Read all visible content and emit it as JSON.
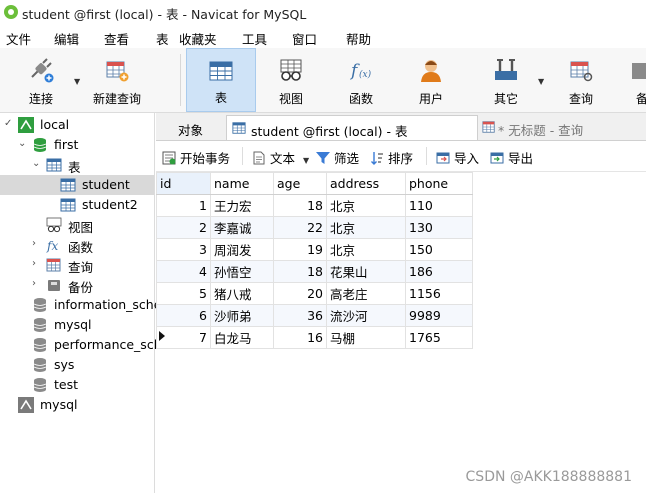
{
  "window": {
    "title": "student @first (local) - 表 - Navicat for MySQL"
  },
  "menu": [
    "文件",
    "编辑",
    "查看",
    "表",
    "收藏夹",
    "工具",
    "窗口",
    "帮助"
  ],
  "toolbar": {
    "buttons": [
      {
        "label": "连接",
        "icon": "connect-icon"
      },
      {
        "label": "新建查询",
        "icon": "new-query-icon"
      },
      {
        "label": "表",
        "icon": "table-icon",
        "active": true
      },
      {
        "label": "视图",
        "icon": "view-icon"
      },
      {
        "label": "函数",
        "icon": "function-icon"
      },
      {
        "label": "用户",
        "icon": "user-icon"
      },
      {
        "label": "其它",
        "icon": "tools-icon"
      },
      {
        "label": "查询",
        "icon": "query-icon"
      },
      {
        "label": "备",
        "icon": "backup-icon"
      }
    ]
  },
  "tree": {
    "connection": "local",
    "database": "first",
    "tables_group": "表",
    "tables": [
      "student",
      "student2"
    ],
    "views": "视图",
    "functions": "函数",
    "queries": "查询",
    "backups": "备份",
    "other_dbs": [
      "information_sche",
      "mysql",
      "performance_sch",
      "sys",
      "test"
    ],
    "second_connection": "mysql"
  },
  "tabs": [
    {
      "label": "对象"
    },
    {
      "label": "student @first (local) - 表",
      "active": true
    },
    {
      "label": "* 无标题 - 查询"
    }
  ],
  "subtoolbar": {
    "begin_transaction": "开始事务",
    "text": "文本",
    "filter": "筛选",
    "sort": "排序",
    "import": "导入",
    "export": "导出"
  },
  "grid": {
    "columns": [
      "id",
      "name",
      "age",
      "address",
      "phone"
    ],
    "rows": [
      [
        "1",
        "王力宏",
        "18",
        "北京",
        "110"
      ],
      [
        "2",
        "李嘉诚",
        "22",
        "北京",
        "130"
      ],
      [
        "3",
        "周润发",
        "19",
        "北京",
        "150"
      ],
      [
        "4",
        "孙悟空",
        "18",
        "花果山",
        "186"
      ],
      [
        "5",
        "猪八戒",
        "20",
        "高老庄",
        "1156"
      ],
      [
        "6",
        "沙师弟",
        "36",
        "流沙河",
        "9989"
      ],
      [
        "7",
        "白龙马",
        "16",
        "马棚",
        "1765"
      ]
    ],
    "current_row": 7
  },
  "watermark": "CSDN @AKK188888881",
  "colors": {
    "accent": "#3a7bd5",
    "selected": "#cfe3f7"
  }
}
